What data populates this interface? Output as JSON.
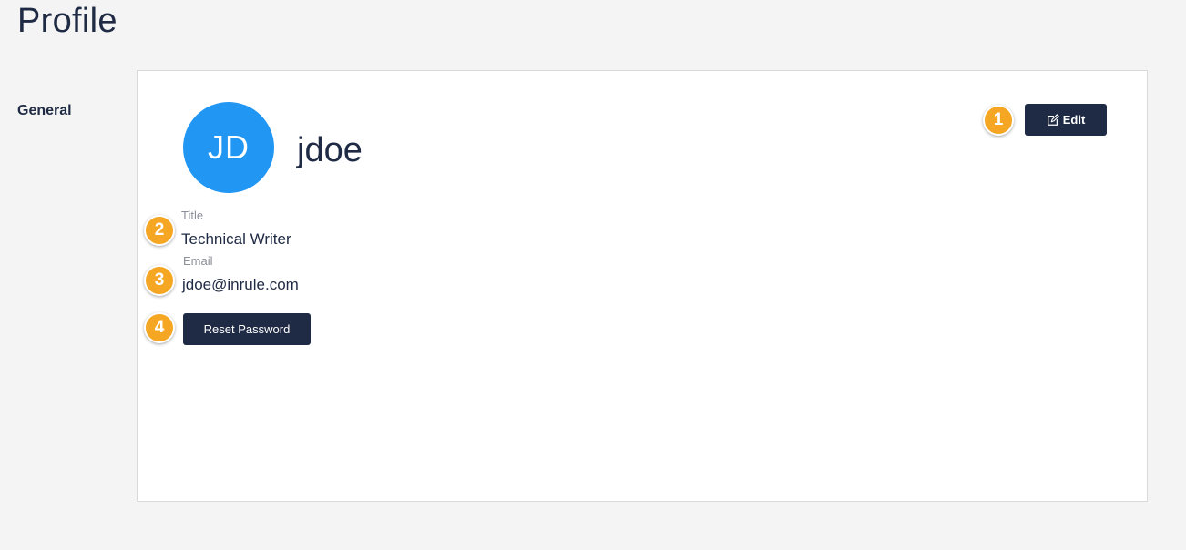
{
  "page": {
    "title": "Profile"
  },
  "sidebar": {
    "items": [
      {
        "label": "General",
        "active": true
      }
    ]
  },
  "profile": {
    "avatar_initials": "JD",
    "avatar_color": "#2196f3",
    "username": "jdoe",
    "edit_label": "Edit",
    "fields": {
      "title": {
        "label": "Title",
        "value": "Technical Writer"
      },
      "email": {
        "label": "Email",
        "value": "jdoe@inrule.com"
      }
    },
    "reset_password_label": "Reset Password"
  },
  "callouts": [
    "1",
    "2",
    "3",
    "4"
  ],
  "colors": {
    "accent": "#f5a623",
    "primary": "#1f2a44",
    "avatar": "#2196f3"
  },
  "icons": {
    "edit": "edit-icon"
  }
}
